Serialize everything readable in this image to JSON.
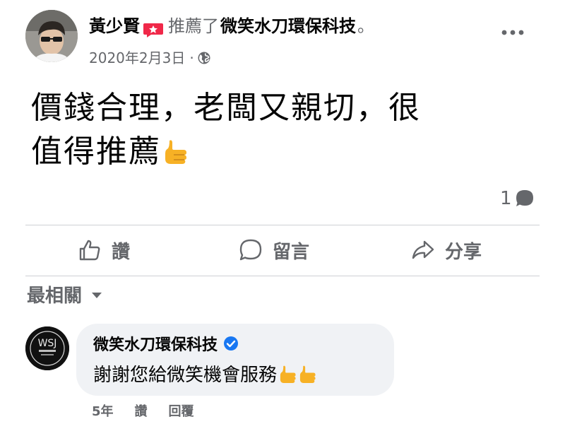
{
  "post": {
    "author": "黃少賢",
    "verb": "推薦了",
    "page": "微笑水刀環保科技",
    "period": "。",
    "date": "2020年2月3日",
    "meta_separator": "·",
    "text_line1": "價錢合理，老闆又親切，很",
    "text_line2": "值得推薦",
    "comment_count": "1"
  },
  "actions": {
    "like": "讚",
    "comment": "留言",
    "share": "分享"
  },
  "sort_label": "最相關",
  "comment": {
    "author": "微笑水刀環保科技",
    "text": "謝謝您給微笑機會服務",
    "avatar_text": "WSJ",
    "age": "5年",
    "like": "讚",
    "reply": "回覆"
  },
  "colors": {
    "secondary_text": "#65676b",
    "divider": "#ced0d4",
    "bubble_bg": "#f0f2f5",
    "verified_blue": "#1877f2",
    "recommend_red": "#f02849",
    "thumb_yellow": "#f7b125"
  },
  "icons": [
    "recommend-badge-icon",
    "more-icon",
    "globe-icon",
    "thumbs-up-emoji-icon",
    "comment-bubble-icon",
    "like-icon",
    "comment-icon",
    "share-icon",
    "chevron-down-icon",
    "verified-icon"
  ]
}
